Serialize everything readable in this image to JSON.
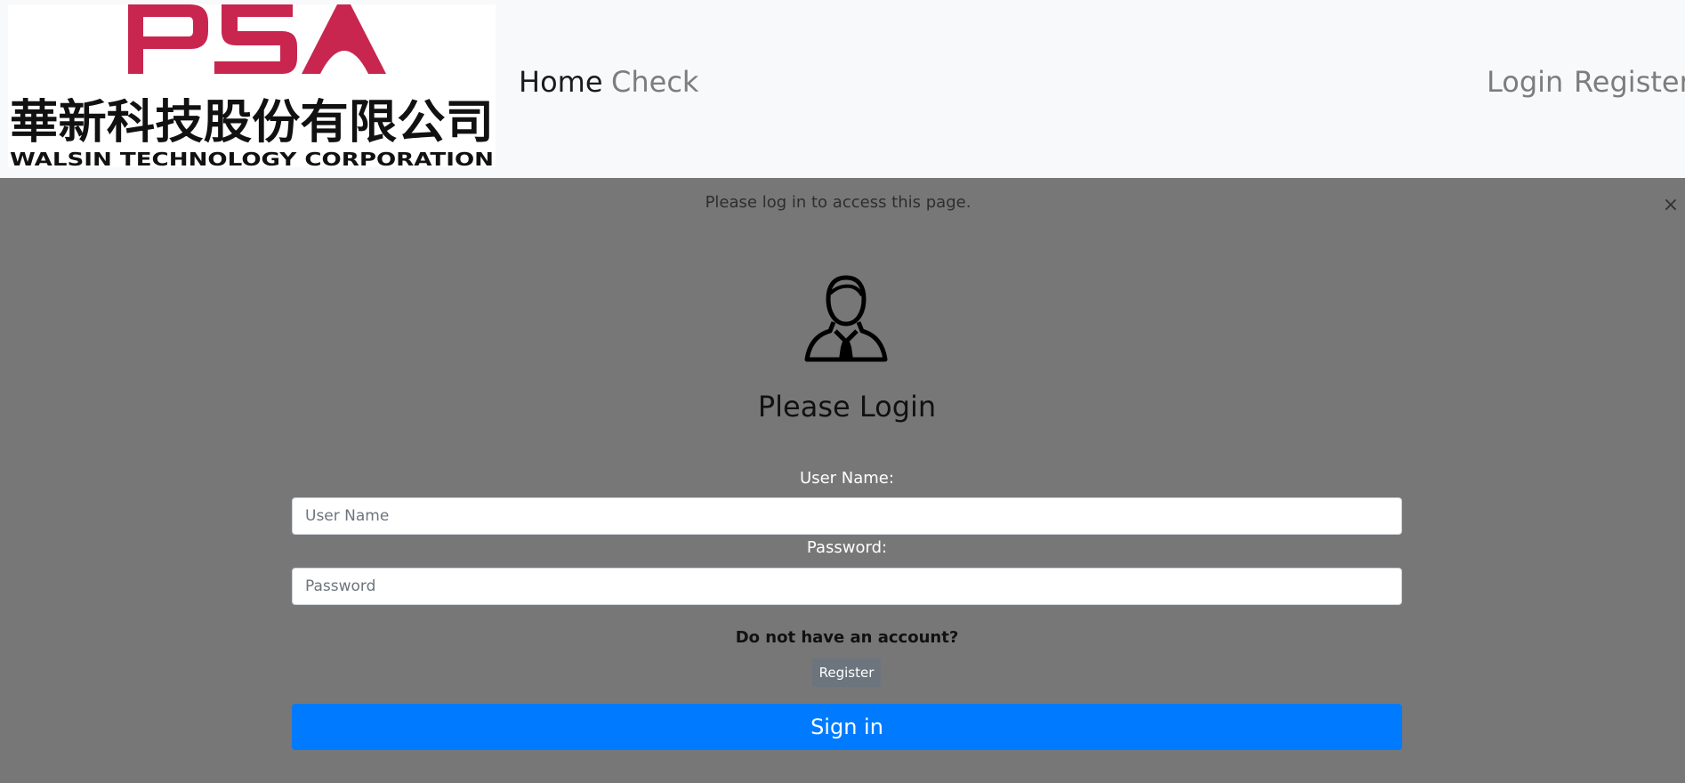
{
  "brand": {
    "logo_text": "PSA",
    "logo_chinese": "華新科技股份有限公司",
    "logo_english": "WALSIN TECHNOLOGY CORPORATION",
    "logo_color": "#c8264f"
  },
  "nav": {
    "home": "Home",
    "check": "Check",
    "login": "Login",
    "register": "Register"
  },
  "alert": {
    "message": "Please log in to access this page.",
    "close": "×"
  },
  "login_form": {
    "user_icon": "user-icon",
    "title": "Please Login",
    "username_label": "User Name:",
    "username_placeholder": "User Name",
    "password_label": "Password:",
    "password_placeholder": "Password",
    "no_account_text": "Do not have an account?",
    "register_button": "Register",
    "signin_button": "Sign in"
  },
  "colors": {
    "navbar_bg": "#f8f9fa",
    "page_bg": "#777777",
    "primary": "#007bff",
    "secondary": "#6c757d"
  }
}
